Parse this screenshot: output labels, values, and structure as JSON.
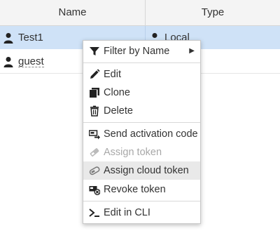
{
  "table": {
    "headers": {
      "name": "Name",
      "type": "Type"
    },
    "rows": [
      {
        "name": "Test1",
        "type": "Local",
        "selected": true
      },
      {
        "name": "guest",
        "type": "",
        "selected": false
      }
    ]
  },
  "context_menu": {
    "items": [
      {
        "label": "Filter by Name",
        "icon": "filter-icon",
        "has_submenu": true
      },
      {
        "label": "Edit",
        "icon": "pencil-icon"
      },
      {
        "label": "Clone",
        "icon": "clone-icon"
      },
      {
        "label": "Delete",
        "icon": "trash-icon"
      },
      {
        "label": "Send activation code",
        "icon": "send-code-icon"
      },
      {
        "label": "Assign token",
        "icon": "token-icon",
        "disabled": true
      },
      {
        "label": "Assign cloud token",
        "icon": "cloud-token-icon",
        "highlighted": true
      },
      {
        "label": "Revoke token",
        "icon": "revoke-token-icon"
      },
      {
        "label": "Edit in CLI",
        "icon": "cli-icon"
      }
    ]
  },
  "colors": {
    "selected_row": "#cfe2f7",
    "menu_hover": "#e9e9e9",
    "disabled_text": "#a8a8a8"
  }
}
